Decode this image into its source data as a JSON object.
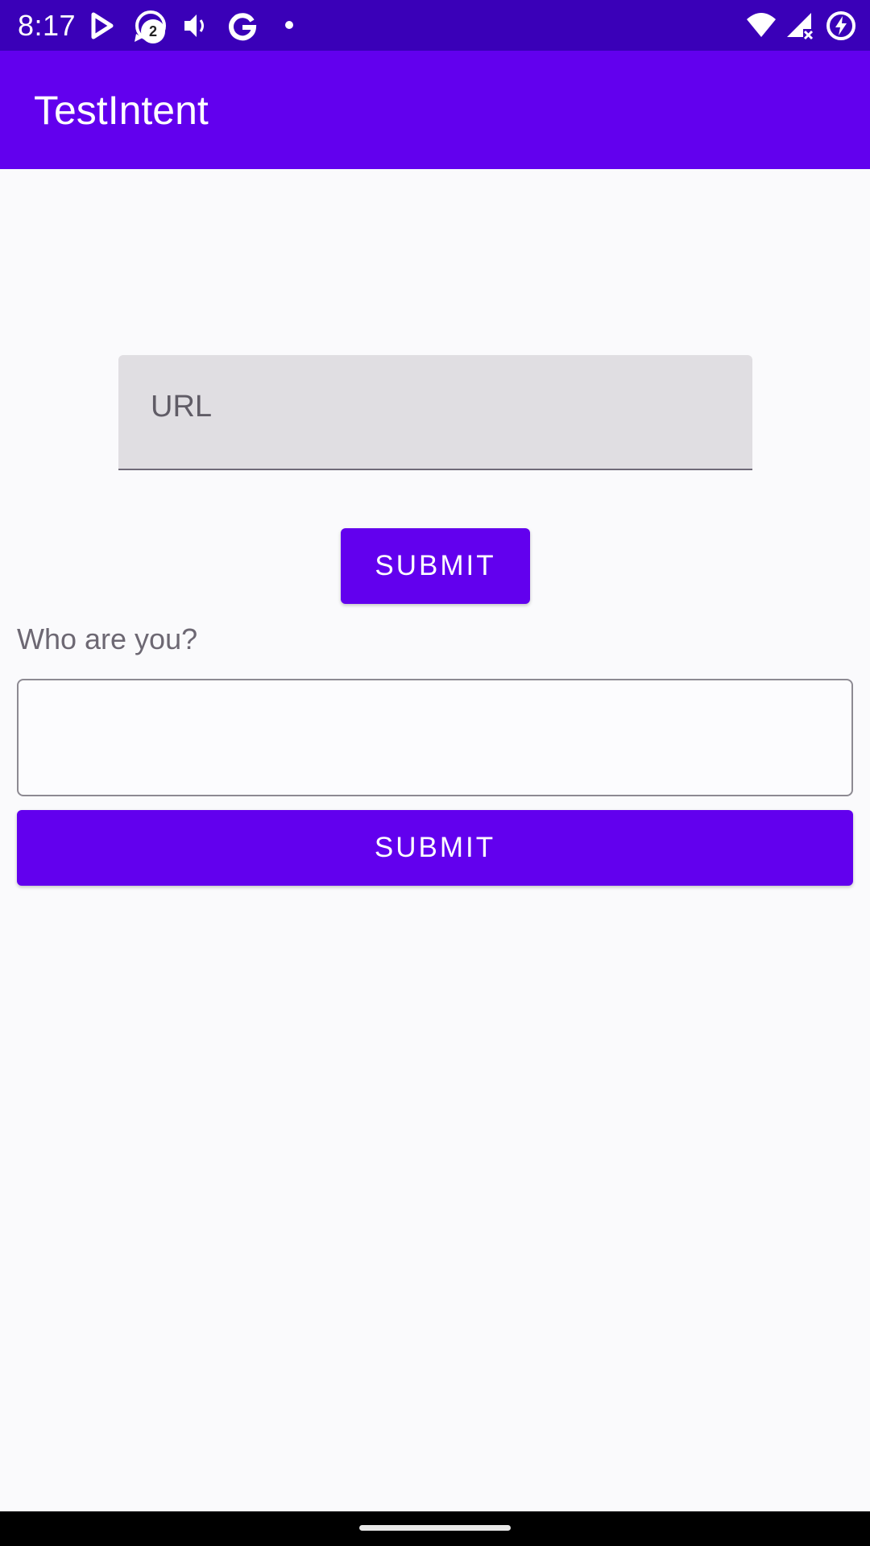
{
  "status_bar": {
    "time": "8:17",
    "notification_count": "2",
    "icons": [
      "play-store-icon",
      "chat-bubble-icon",
      "volume-icon",
      "google-icon",
      "dot-icon",
      "wifi-icon",
      "signal-no-data-icon",
      "battery-charging-icon"
    ]
  },
  "app_bar": {
    "title": "TestIntent"
  },
  "url_section": {
    "placeholder": "URL",
    "value": "",
    "submit_label": "SUBMIT"
  },
  "identity_section": {
    "prompt": "Who are you?",
    "value": "",
    "submit_label": "SUBMIT"
  },
  "colors": {
    "status_bar": "#3a00b8",
    "primary": "#6200ee",
    "background": "#fafafc"
  }
}
